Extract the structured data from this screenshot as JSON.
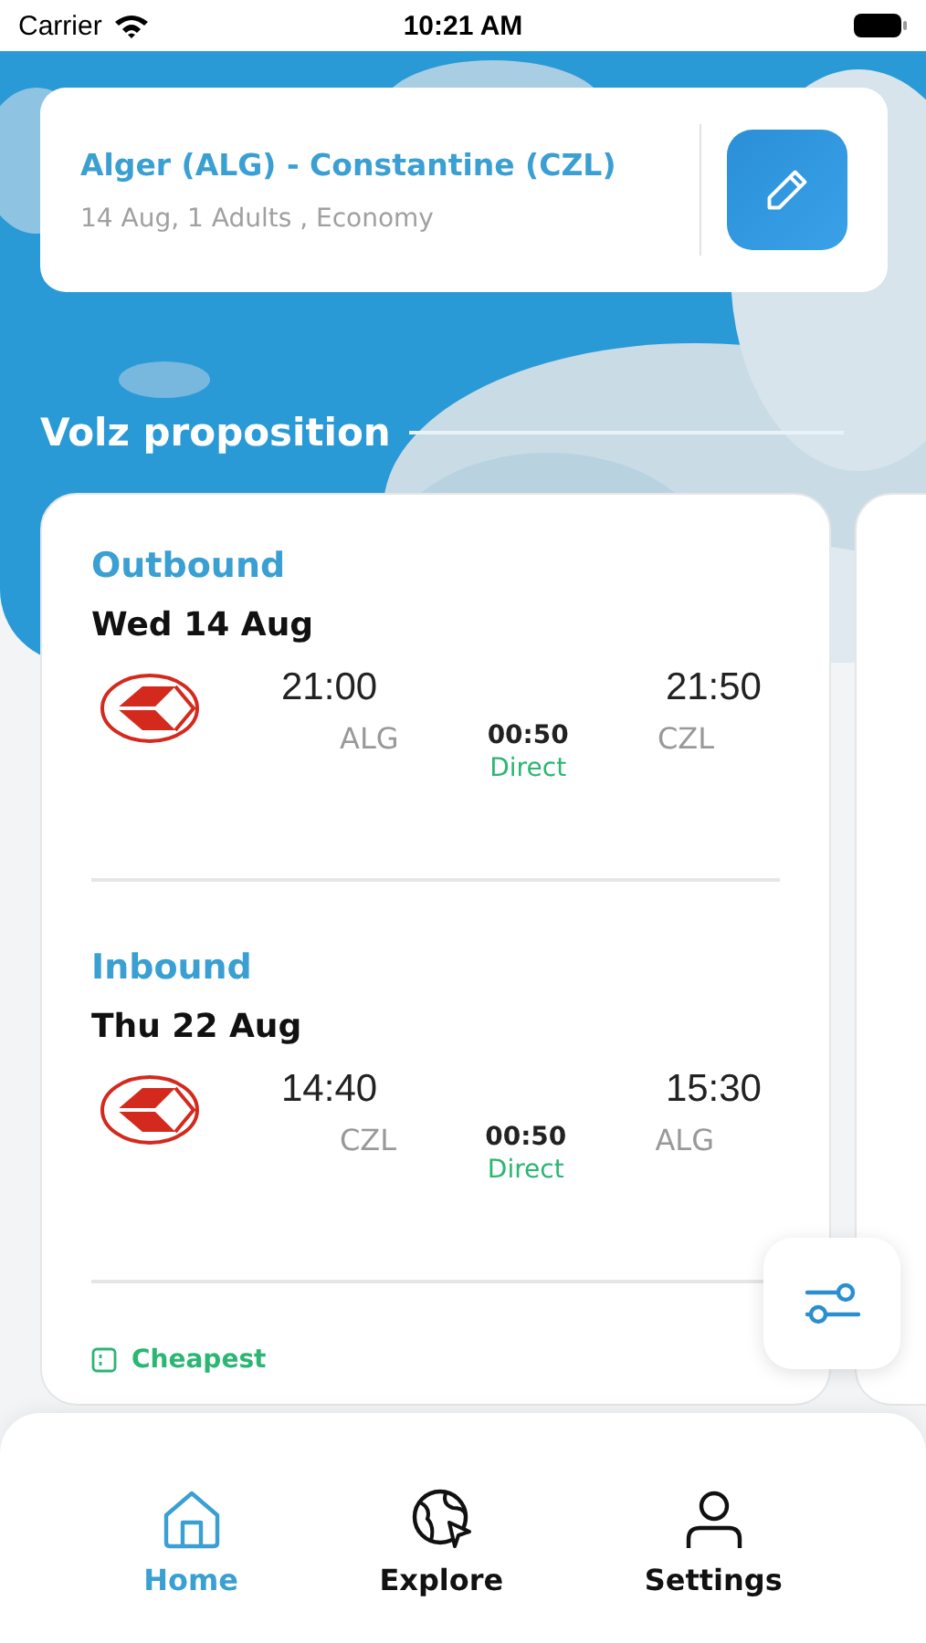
{
  "status_bar": {
    "carrier": "Carrier",
    "time": "10:21 AM"
  },
  "search": {
    "route": "Alger (ALG) - Constantine (CZL)",
    "details": "14 Aug, 1 Adults , Economy"
  },
  "section_title": "Volz proposition",
  "proposition": {
    "legs": [
      {
        "label": "Outbound",
        "date": "Wed 14 Aug",
        "depart_time": "21:00",
        "arrive_time": "21:50",
        "from": "ALG",
        "to": "CZL",
        "duration": "00:50",
        "stops": "Direct"
      },
      {
        "label": "Inbound",
        "date": "Thu 22 Aug",
        "depart_time": "14:40",
        "arrive_time": "15:30",
        "from": "CZL",
        "to": "ALG",
        "duration": "00:50",
        "stops": "Direct"
      }
    ],
    "tag": "Cheapest"
  },
  "tabs": [
    {
      "label": "Home",
      "selected": true
    },
    {
      "label": "Explore",
      "selected": false
    },
    {
      "label": "Settings",
      "selected": false
    }
  ]
}
